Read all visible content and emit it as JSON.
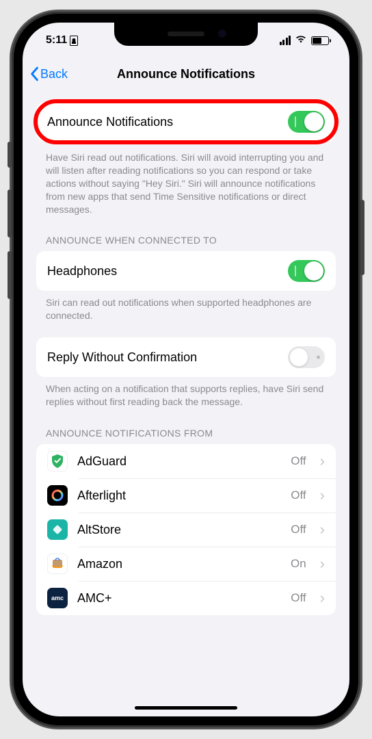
{
  "status": {
    "time": "5:11"
  },
  "nav": {
    "back": "Back",
    "title": "Announce Notifications"
  },
  "announce": {
    "label": "Announce Notifications",
    "desc": "Have Siri read out notifications. Siri will avoid interrupting you and will listen after reading notifications so you can respond or take actions without saying \"Hey Siri.\" Siri will announce notifications from new apps that send Time Sensitive notifications or direct messages."
  },
  "connected": {
    "header": "ANNOUNCE WHEN CONNECTED TO",
    "headphones": "Headphones",
    "desc": "Siri can read out notifications when supported headphones are connected."
  },
  "reply": {
    "label": "Reply Without Confirmation",
    "desc": "When acting on a notification that supports replies, have Siri send replies without first reading back the message."
  },
  "apps_header": "ANNOUNCE NOTIFICATIONS FROM",
  "apps": [
    {
      "name": "AdGuard",
      "state": "Off"
    },
    {
      "name": "Afterlight",
      "state": "Off"
    },
    {
      "name": "AltStore",
      "state": "Off"
    },
    {
      "name": "Amazon",
      "state": "On"
    },
    {
      "name": "AMC+",
      "state": "Off"
    }
  ]
}
